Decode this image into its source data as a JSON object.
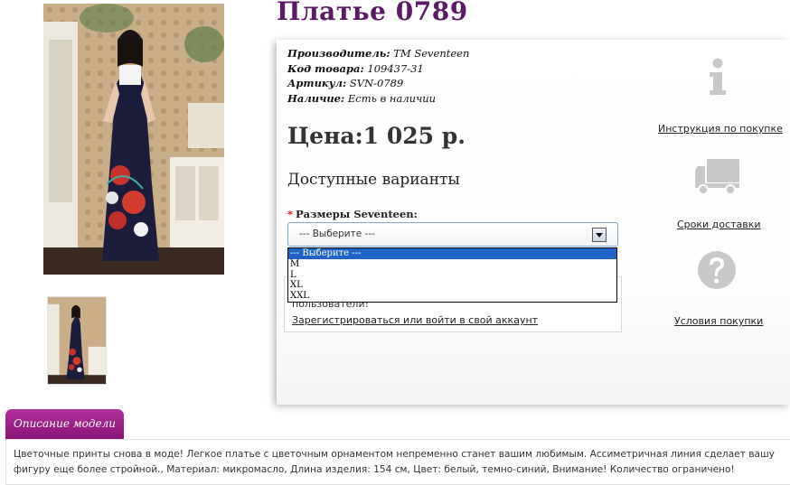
{
  "product": {
    "title": "Платье 0789",
    "meta": [
      {
        "key": "Производитель:",
        "value": "TM Seventeen"
      },
      {
        "key": "Код товара:",
        "value": "109437-31"
      },
      {
        "key": "Артикул:",
        "value": "SVN-0789"
      },
      {
        "key": "Наличие:",
        "value": "Есть в наличии"
      }
    ],
    "price": "Цена:1 025 р.",
    "variants_title": "Доступные варианты",
    "size_label": "Размеры Seventeen:",
    "required_mark": "*",
    "select": {
      "selected": "--- Выберите ---",
      "options": [
        "--- Выберите ---",
        "M",
        "L",
        "XL",
        "XXL"
      ]
    },
    "login": {
      "note": "пользователи!",
      "link": "Зарегистрироваться или войти в свой аккаунт"
    }
  },
  "side_links": {
    "instructions": "Инструкция по покупке",
    "delivery": "Сроки доставки",
    "conditions": "Условия покупки"
  },
  "icons": {
    "info": "info-icon",
    "truck": "truck-icon",
    "question": "question-icon"
  },
  "description": {
    "tab_label": "Описание модели",
    "text": "Цветочные принты снова в моде! Легкое платье с цветочным орнаментом непременно станет вашим любимым. Ассиметричная линия сделает вашу фигуру еще более стройной., Материал: микромасло, Длина изделия: 154 см, Цвет: белый, темно-синий, Внимание! Количество ограничено!"
  },
  "colors": {
    "title": "#5b1a64",
    "tab": "#9c2389",
    "select_border": "#7ea6d6",
    "dropdown_active": "#1e63c5",
    "icon_gray": "#c8c8c8"
  }
}
